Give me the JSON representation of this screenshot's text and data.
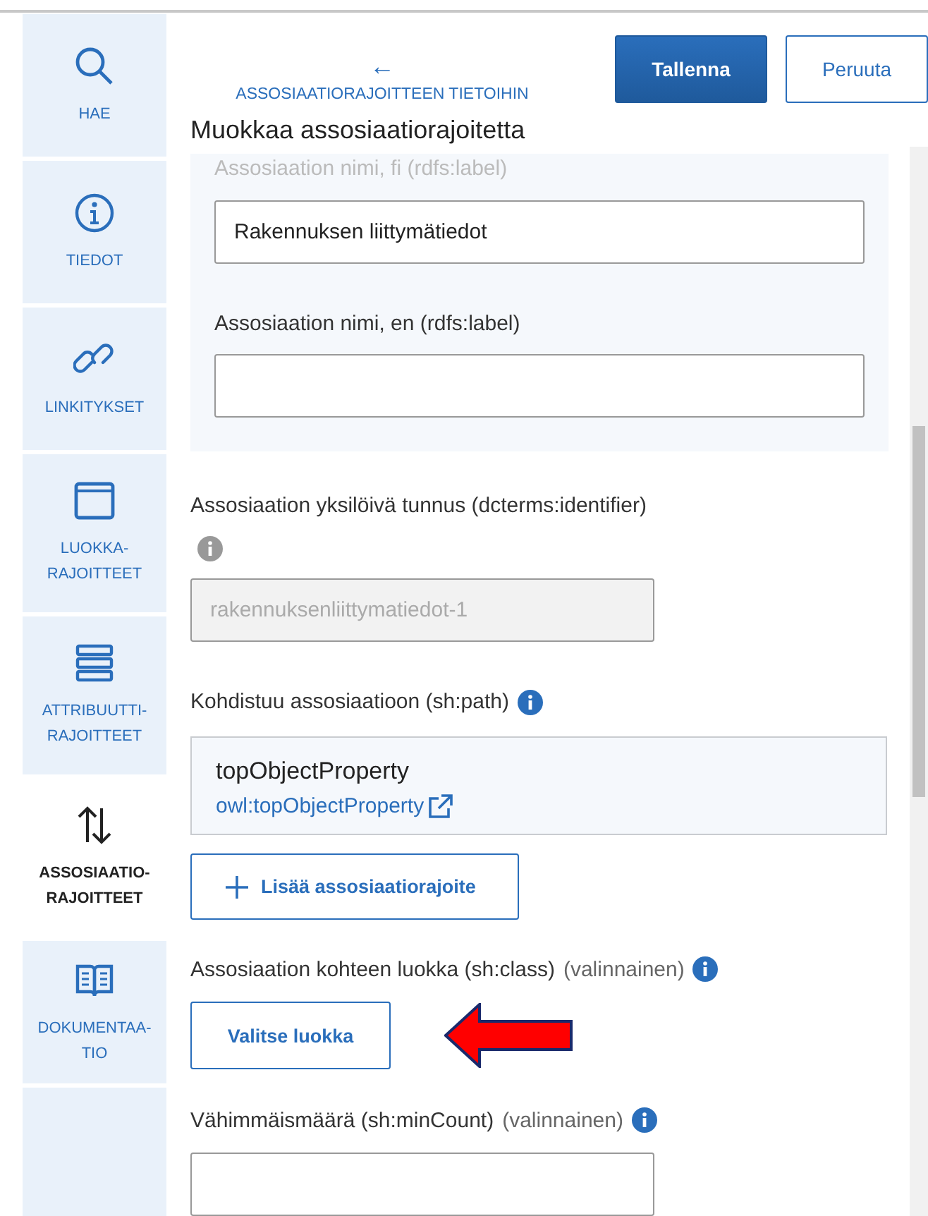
{
  "sidebar": {
    "items": [
      {
        "label": "HAE",
        "kind": "search",
        "selected": false
      },
      {
        "label": "TIEDOT",
        "kind": "info",
        "selected": false
      },
      {
        "label": "LINKITYKSET",
        "kind": "link",
        "selected": false
      },
      {
        "label": "LUOKKA-RAJOITTEET",
        "kind": "window",
        "selected": false
      },
      {
        "label": "ATTRIBUUTTI-RAJOITTEET",
        "kind": "rows",
        "selected": false
      },
      {
        "label": "ASSOSIAATIO-RAJOITTEET",
        "kind": "arrows",
        "selected": true
      },
      {
        "label": "DOKUMENTAA-TIO",
        "kind": "book",
        "selected": false
      }
    ]
  },
  "header": {
    "back_arrow": "←",
    "back_link": "ASSOSIAATIORAJOITTEEN TIETOIHIN",
    "buttons": [
      {
        "label": "Tallenna",
        "kind": "primary"
      },
      {
        "label": "Peruuta",
        "kind": "secondary"
      }
    ]
  },
  "form": {
    "title": "Muokkaa assosiaatiorajoitetta",
    "names_panel": {
      "fields": [
        {
          "label": "Assosiaation nimi, fi (rdfs:label)",
          "value": "Rakennuksen liittymätiedot"
        },
        {
          "label": "Assosiaation nimi, en (rdfs:label)"
        }
      ]
    },
    "identifier": {
      "label": "Assosiaation yksilöivä tunnus (dcterms:identifier)",
      "value": "rakennuksenliittymatiedot-1",
      "disabled": true
    },
    "path": {
      "label": "Kohdistuu assosiaatioon (sh:path)",
      "name": "topObjectProperty",
      "link": "owl:topObjectProperty"
    },
    "add_button": "Lisää assosiaatiorajoite",
    "target_class": {
      "label": "Assosiaation kohteen luokka (sh:class)",
      "optional": "(valinnainen)",
      "button": "Valitse luokka"
    },
    "min_count": {
      "label": "Vähimmäismäärä (sh:minCount)",
      "optional": "(valinnainen)"
    }
  }
}
